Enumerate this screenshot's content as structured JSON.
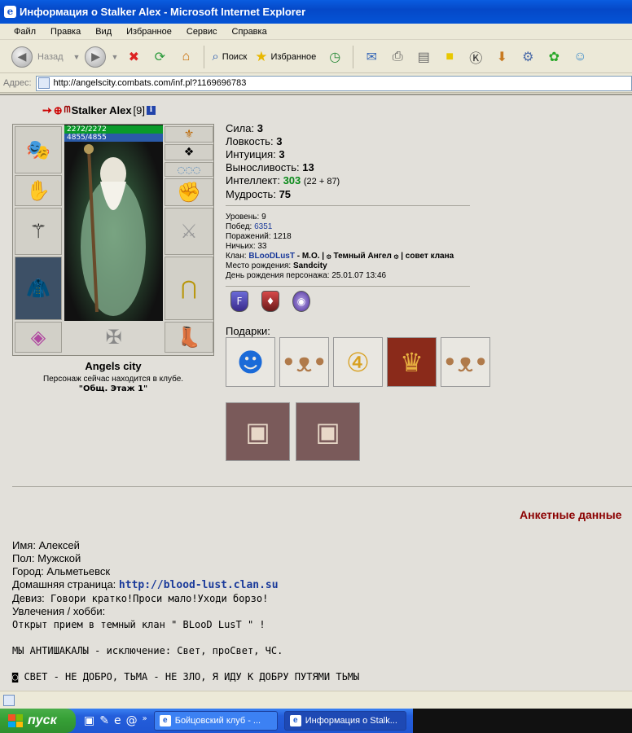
{
  "window": {
    "title": "Информация о Stalker Alex - Microsoft Internet Explorer"
  },
  "menu": [
    "Файл",
    "Правка",
    "Вид",
    "Избранное",
    "Сервис",
    "Справка"
  ],
  "toolbar": {
    "back_label": "Назад",
    "search_label": "Поиск",
    "favorites_label": "Избранное"
  },
  "address": {
    "label": "Адрес:",
    "url": "http://angelscity.combats.com/inf.pl?1169696783"
  },
  "character": {
    "name": "Stalker Alex",
    "level_tag": "[9]",
    "info_icon": "i",
    "hp": "2272/2272",
    "mana": "4855/4855",
    "city": "Angels city",
    "location_text": "Персонаж сейчас находится в клубе.",
    "room": "\"Общ. Этаж 1\""
  },
  "stats": [
    {
      "label": "Сила:",
      "value": "3"
    },
    {
      "label": "Ловкость:",
      "value": "3"
    },
    {
      "label": "Интуиция:",
      "value": "3"
    },
    {
      "label": "Выносливость:",
      "value": "13"
    },
    {
      "label": "Интеллект:",
      "value": "303",
      "extra": "(22 + 87)"
    },
    {
      "label": "Мудрость:",
      "value": "75"
    }
  ],
  "details": {
    "level_label": "Уровень:",
    "level": "9",
    "wins_label": "Побед:",
    "wins": "6351",
    "losses_label": "Поражений:",
    "losses": "1218",
    "draws_label": "Ничьих:",
    "draws": "33",
    "clan_label": "Клан:",
    "clan_name": "BLooDLusT",
    "clan_rest": " - M.O. | ۞ Темный Ангел ۞ | совет клана",
    "birthplace_label": "Место рождения:",
    "birthplace": "Sandcity",
    "birthday_label": "День рождения персонажа:",
    "birthday": "25.01.07 13:46"
  },
  "gifts_label": "Подарки:",
  "gifts": [
    "smiley-santa-hat",
    "teddy-bear-santa",
    "gold-medal-4",
    "clan-banner",
    "teddy-bear-santa",
    "book-card",
    "book-card"
  ],
  "anketa": {
    "title": "Анкетные данные",
    "name_label": "Имя:",
    "name": "Алексей",
    "sex_label": "Пол:",
    "sex": "Мужской",
    "town_label": "Город:",
    "town": "Альметьевск",
    "home_label": "Домашняя страница:",
    "home": "http://blood-lust.clan.su",
    "motto_label": "Девиз:",
    "motto": "Говори кратко!Проси мало!Уходи борзо!",
    "hobby_label": "Увлечения / хобби:",
    "hobby_line1": "Открыт прием в темный клан \" BLooD LusT \" !",
    "hobby_line2": "МЫ АНТИШАКАЛЫ - исключение: Свет, проСвет, ЧС.",
    "hobby_line3": "◙ СВЕТ - НЕ ДОБРО, ТЬМА - НЕ ЗЛО, Я ИДУ К ДОБРУ ПУТЯМИ ТЬМЫ"
  },
  "taskbar": {
    "start": "пуск",
    "task1": "Бойцовский клуб - ...",
    "task2": "Информация о Stalk..."
  },
  "colors": {
    "accent_red": "#8b0000",
    "link_blue": "#1a3a9a",
    "int_green": "#0a8a1a"
  }
}
